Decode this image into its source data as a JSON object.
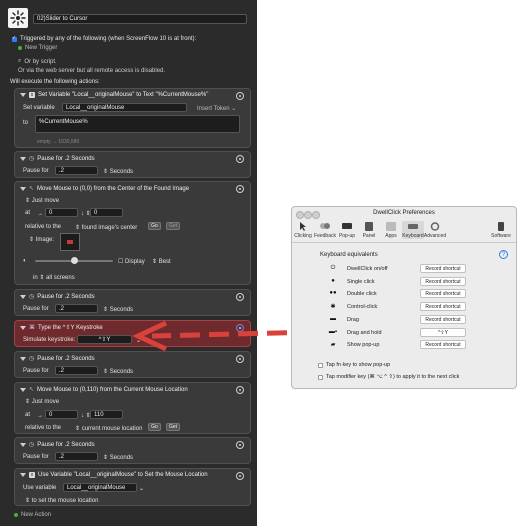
{
  "macro": {
    "name": "02)Slider to Cursor",
    "trigger_text": "Triggered by any of the following (when ScreenFlow 10 is at front):",
    "new_trigger": "New Trigger",
    "or_by_script": "Or by script.",
    "or_via_web": "Or via the web server but all remote access is disabled.",
    "will_execute": "Will execute the following actions:",
    "new_action": "New Action"
  },
  "actions": {
    "set_var": {
      "title": "Set Variable \"Local__originalMouse\" to Text \"%CurrentMouse%\"",
      "set_label": "Set variable",
      "var_name": "Local__originalMouse",
      "insert_token": "Insert Token",
      "to_label": "to",
      "value": "%CurrentMouse%",
      "empty_hint": "empty → 1030,580"
    },
    "pause1": {
      "title": "Pause for .2 Seconds",
      "label": "Pause for",
      "value": ".2",
      "unit": "Seconds"
    },
    "move1": {
      "title": "Move Mouse to (0,0) from the Center of the Found Image",
      "just_move": "Just move",
      "at_label": "at",
      "x": "0",
      "y": "0",
      "relative_label": "relative to the",
      "relative_value": "found image's center",
      "go": "Go",
      "get": "Get",
      "image_label": "Image:",
      "display": "Display",
      "best": "Best",
      "in_label": "in",
      "in_value": "all screens"
    },
    "pause2": {
      "title": "Pause for .2 Seconds",
      "label": "Pause for",
      "value": ".2",
      "unit": "Seconds"
    },
    "keystroke": {
      "title": "Type the ^⇧Y Keystroke",
      "label": "Simulate keystroke:",
      "value": "^⇧Y"
    },
    "pause3": {
      "title": "Pause for .2 Seconds",
      "label": "Pause for",
      "value": ".2",
      "unit": "Seconds"
    },
    "move2": {
      "title": "Move Mouse to (0,110) from the Current Mouse Location",
      "just_move": "Just move",
      "at_label": "at",
      "x": "0",
      "y": "110",
      "relative_label": "relative to the",
      "relative_value": "current mouse location",
      "go": "Go",
      "get": "Get"
    },
    "pause4": {
      "title": "Pause for .2 Seconds",
      "label": "Pause for",
      "value": ".2",
      "unit": "Seconds"
    },
    "use_var": {
      "title": "Use Variable \"Local__originalMouse\" to Set the Mouse Location",
      "label": "Use variable",
      "var_name": "Local__originalMouse",
      "to_set": "to set the mouse location"
    }
  },
  "prefs": {
    "title": "DwellClick Preferences",
    "toolbar": [
      "Clicking",
      "Feedback",
      "Pop-up",
      "Panel",
      "Apps",
      "Keyboard",
      "Advanced",
      "Software"
    ],
    "section": "Keyboard equivalents",
    "help": "?",
    "rows": [
      {
        "symbol": "⏻",
        "label": "DwellClick on/off",
        "button": "Record shortcut"
      },
      {
        "symbol": "●",
        "label": "Single click",
        "button": "Record shortcut"
      },
      {
        "symbol": "●●",
        "label": "Double click",
        "button": "Record shortcut"
      },
      {
        "symbol": "✱",
        "label": "Control-click",
        "button": "Record shortcut"
      },
      {
        "symbol": "▬",
        "label": "Drag",
        "button": "Record shortcut"
      },
      {
        "symbol": "▬▪",
        "label": "Drag and hold",
        "button": "^⇧Y"
      },
      {
        "symbol": "▰",
        "label": "Show pop-up",
        "button": "Record shortcut"
      }
    ],
    "tap_fn": "Tap fn key to show pop-up",
    "tap_mod": "Tap modifier key (⌘ ⌥ ^ ⇧) to apply it to the next click"
  },
  "colors": {
    "arrow": "#d9413d",
    "highlight": "#6e2a2c",
    "accent": "#2f7cf6"
  }
}
